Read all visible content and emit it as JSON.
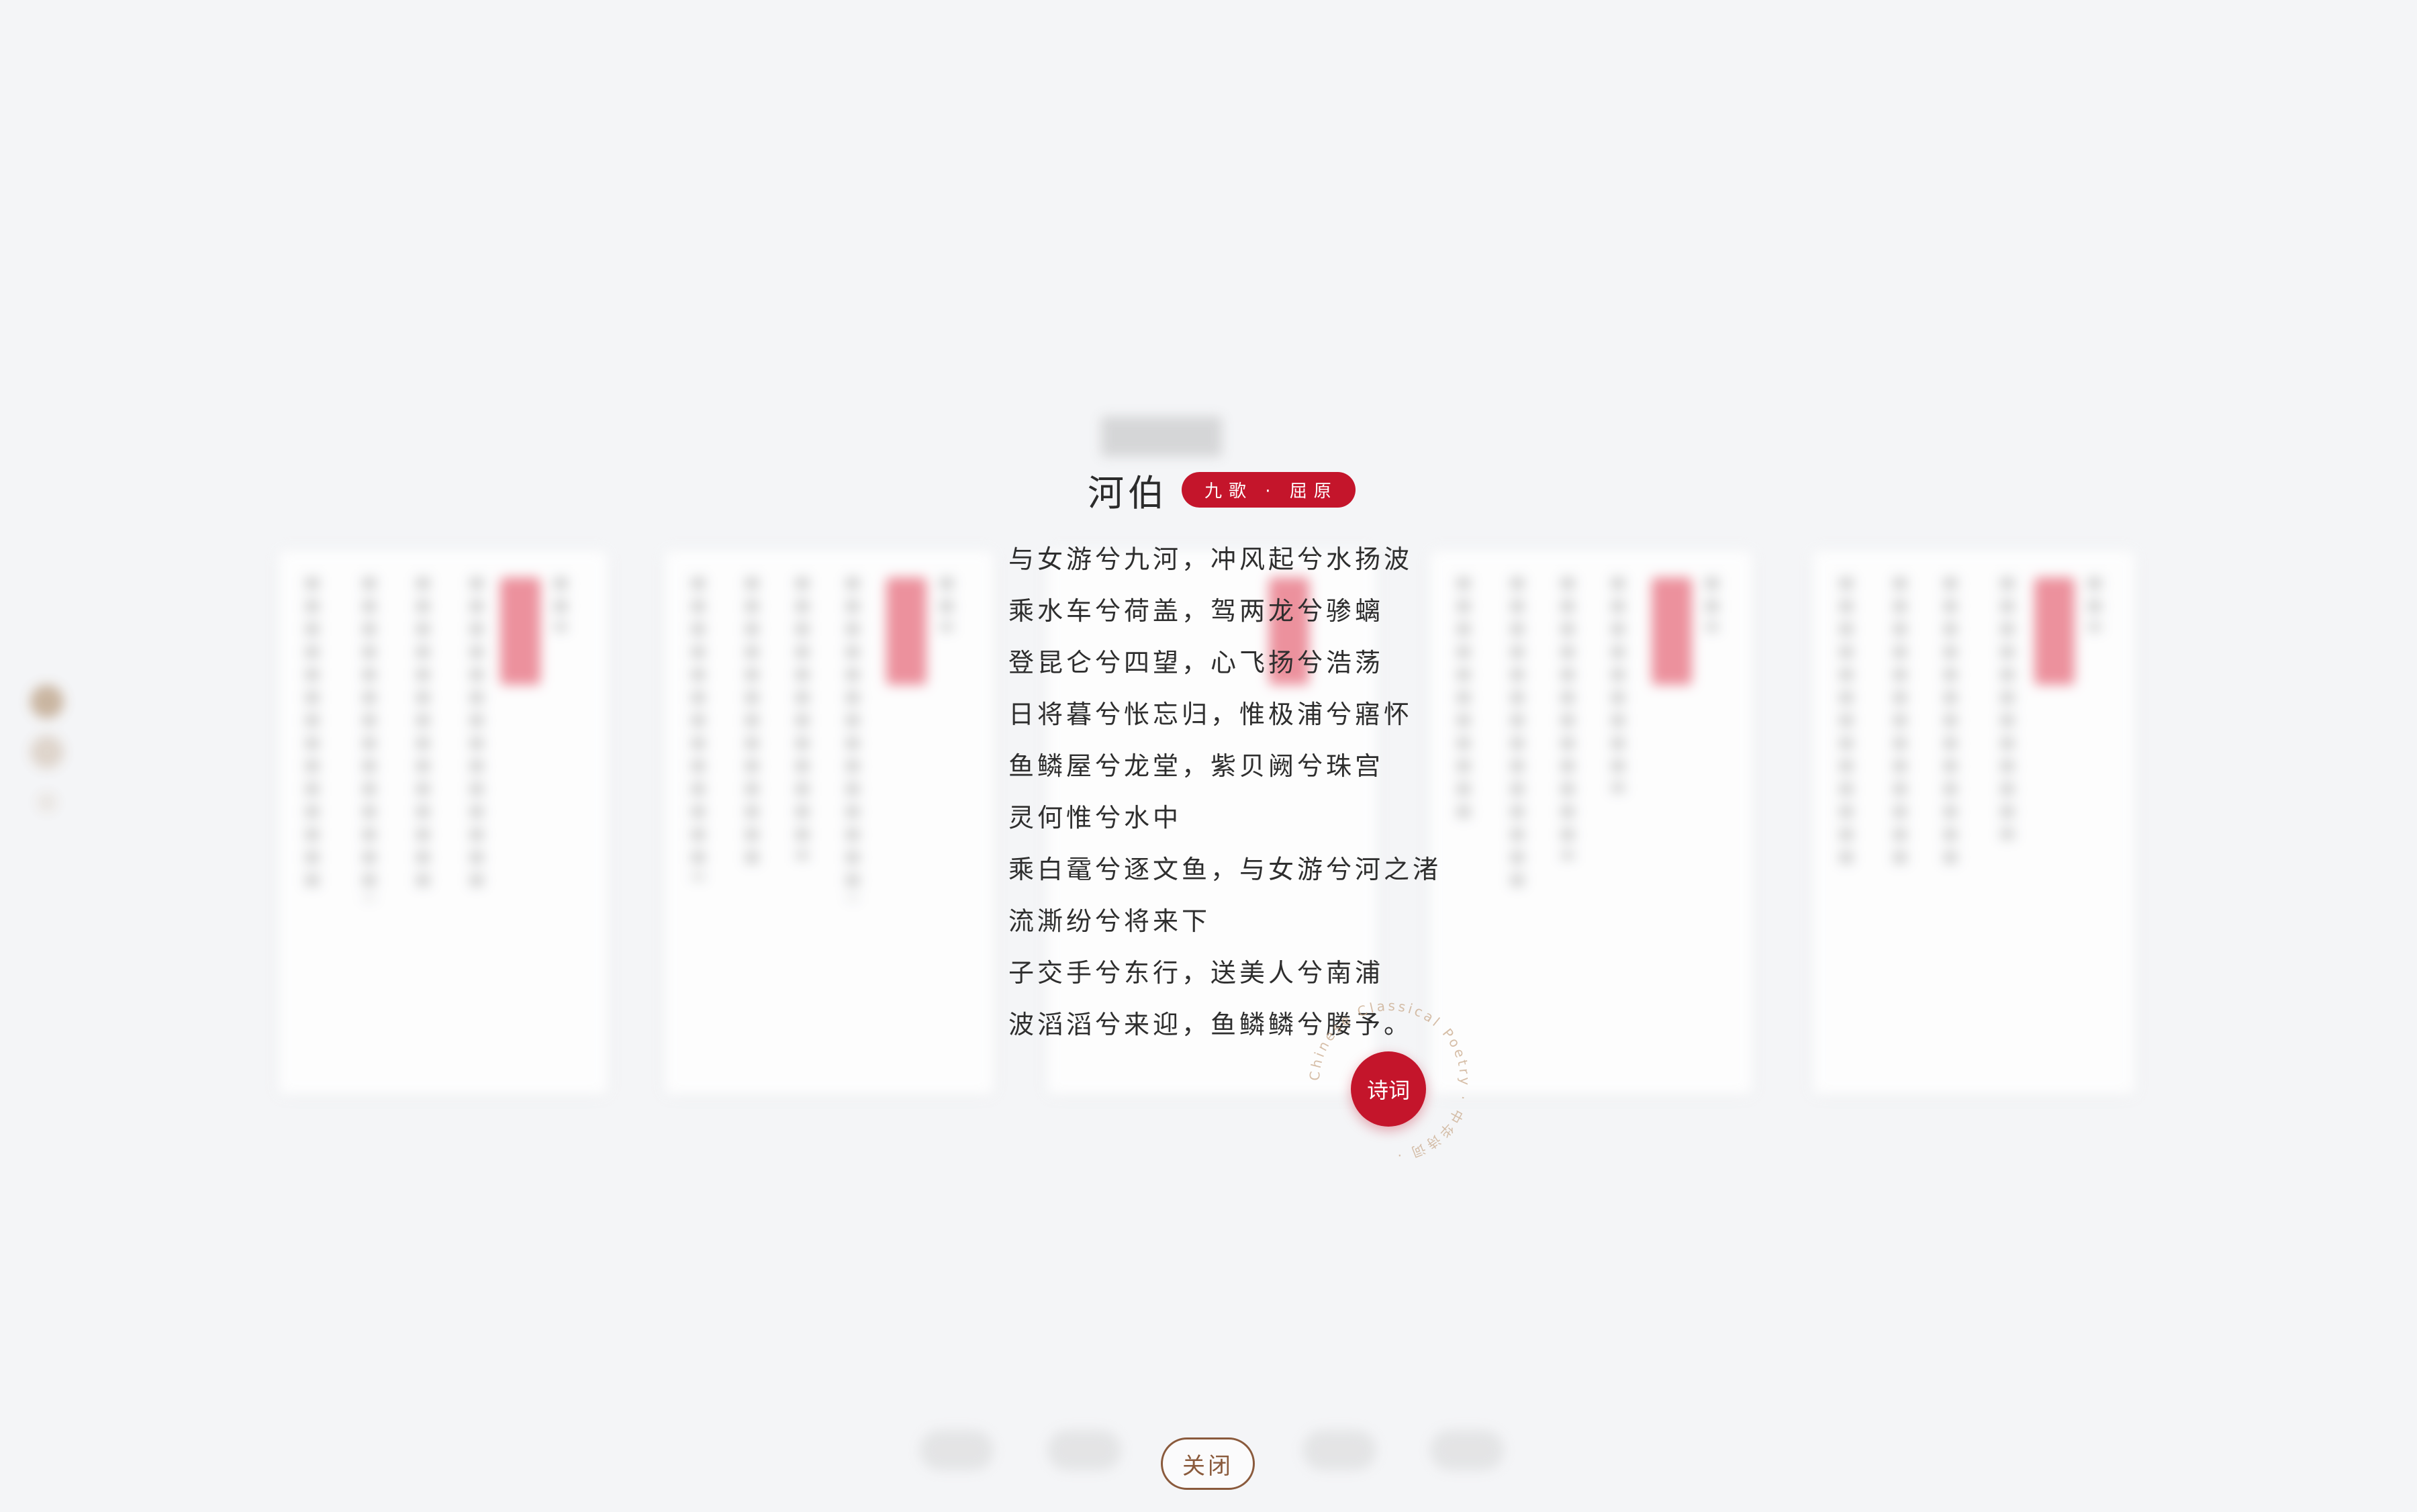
{
  "poem": {
    "title": "河伯",
    "badge": "九歌 · 屈原",
    "lines": [
      "与女游兮九河，冲风起兮水扬波",
      "乘水车兮荷盖，驾两龙兮骖螭",
      "登昆仑兮四望，心飞扬兮浩荡",
      "日将暮兮怅忘归，惟极浦兮寤怀",
      "鱼鳞屋兮龙堂，紫贝阙兮珠宫",
      "灵何惟兮水中",
      "乘白鼋兮逐文鱼，与女游兮河之渚",
      "流澌纷兮将来下",
      "子交手兮东行，送美人兮南浦",
      "波滔滔兮来迎，鱼鳞鳞兮媵予。"
    ]
  },
  "fab": {
    "label": "诗词",
    "ring_text": "Chinese Classical Poetry · 中华诗词 ·"
  },
  "close_label": "关闭",
  "colors": {
    "accent_red": "#c4152b",
    "brown": "#8a5a3c",
    "background": "#f4f5f7"
  }
}
